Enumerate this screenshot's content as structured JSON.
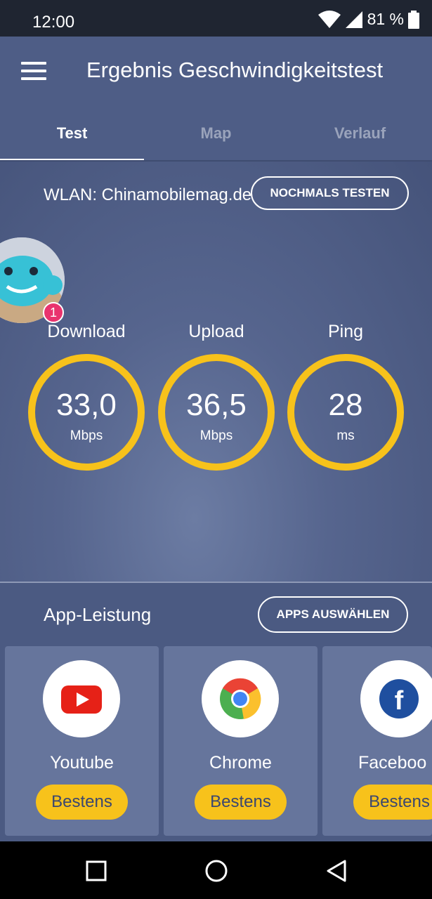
{
  "status_bar": {
    "time": "12:00",
    "battery": "81 %"
  },
  "header": {
    "title": "Ergebnis Geschwindigkeitstest",
    "menu_icon": "hamburger-menu-icon"
  },
  "tabs": [
    {
      "label": "Test",
      "active": true
    },
    {
      "label": "Map",
      "active": false
    },
    {
      "label": "Verlauf",
      "active": false
    }
  ],
  "test": {
    "network": "WLAN: Chinamobilemag.de",
    "retest_label": "NOCHMALS TESTEN",
    "notification_count": "1",
    "metrics": [
      {
        "label": "Download",
        "value": "33,0",
        "unit": "Mbps"
      },
      {
        "label": "Upload",
        "value": "36,5",
        "unit": "Mbps"
      },
      {
        "label": "Ping",
        "value": "28",
        "unit": "ms"
      }
    ]
  },
  "apps": {
    "title": "App-Leistung",
    "select_label": "APPS AUSWÄHLEN",
    "items": [
      {
        "name": "Youtube",
        "rating": "Bestens",
        "icon": "youtube-icon"
      },
      {
        "name": "Chrome",
        "rating": "Bestens",
        "icon": "chrome-icon"
      },
      {
        "name": "Faceboo",
        "rating": "Bestens",
        "icon": "facebook-icon"
      }
    ]
  },
  "colors": {
    "accent": "#f7c21b",
    "background": "#4e5d86",
    "badge": "#e9336e"
  },
  "nav": [
    "recents-square-icon",
    "home-circle-icon",
    "back-triangle-icon"
  ]
}
